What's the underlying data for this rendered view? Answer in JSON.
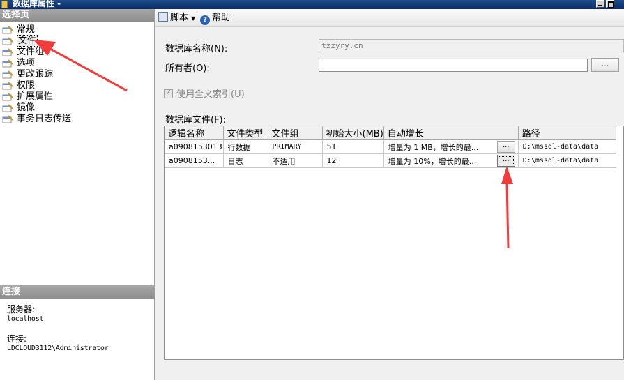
{
  "window": {
    "title": "数据库属性 -"
  },
  "left": {
    "select_page_header": "选择页",
    "nav_items": [
      {
        "label": "常规"
      },
      {
        "label": "文件"
      },
      {
        "label": "文件组"
      },
      {
        "label": "选项"
      },
      {
        "label": "更改跟踪"
      },
      {
        "label": "权限"
      },
      {
        "label": "扩展属性"
      },
      {
        "label": "镜像"
      },
      {
        "label": "事务日志传送"
      }
    ],
    "connect_header": "连接",
    "server_label": "服务器:",
    "server_value": "localhost",
    "connection_label": "连接:",
    "connection_value": "LDCLOUD3112\\Administrator"
  },
  "toolbar": {
    "script_label": "脚本",
    "help_label": "帮助"
  },
  "form": {
    "dbname_label": "数据库名称(N):",
    "dbname_value": "tzzyry.cn",
    "owner_label": "所有者(O):",
    "owner_value": "",
    "dots": "...",
    "fulltext_label": "使用全文索引(U)",
    "files_label": "数据库文件(F):"
  },
  "grid": {
    "columns": [
      "逻辑名称",
      "文件类型",
      "文件组",
      "初始大小(MB)",
      "自动增长",
      "路径"
    ],
    "rows": [
      {
        "logical": "a0908153013",
        "type": "行数据",
        "group": "PRIMARY",
        "size": "51",
        "growth": "增量为 1 MB，增长的最...",
        "btn": "...",
        "path": "D:\\mssql-data\\data"
      },
      {
        "logical": "a0908153...",
        "type": "日志",
        "group": "不适用",
        "size": "12",
        "growth": "增量为 10%，增长的最...",
        "btn": "...",
        "path": "D:\\mssql-data\\data"
      }
    ]
  },
  "colors": {
    "arrow": "#f03c3c",
    "title_bar": "#0a2a66",
    "pane_header": "#8c8c8c"
  }
}
